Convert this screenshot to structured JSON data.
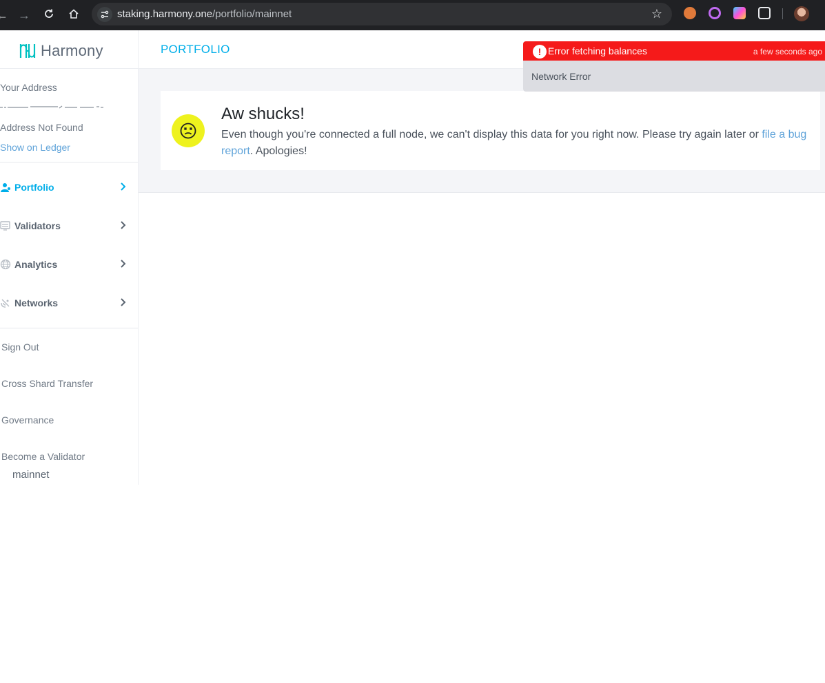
{
  "browser": {
    "url_host": "staking.harmony.one",
    "url_path": "/portfolio/mainnet"
  },
  "app": {
    "logo_text": "Harmony",
    "page_title": "PORTFOLIO"
  },
  "sidebar": {
    "address_label": "Your Address",
    "address_status": "Address Not Found",
    "show_ledger": "Show on Ledger",
    "menu": [
      {
        "label": "Portfolio",
        "icon": "user-icon",
        "active": true
      },
      {
        "label": "Validators",
        "icon": "validators-icon",
        "active": false
      },
      {
        "label": "Analytics",
        "icon": "globe-icon",
        "active": false
      },
      {
        "label": "Networks",
        "icon": "satellite-icon",
        "active": false
      }
    ],
    "links": [
      "Sign Out",
      "Cross Shard Transfer",
      "Governance",
      "Become a Validator"
    ],
    "network": "mainnet"
  },
  "card": {
    "title": "Aw shucks!",
    "body_before": "Even though you're connected a full node, we can't display this data for you right now. Please try again later or ",
    "link": "file a bug report",
    "body_after": ". Apologies!"
  },
  "toast": {
    "title": "Error fetching balances",
    "time": "a few seconds ago",
    "message": "Network Error"
  },
  "colors": {
    "accent": "#00aee9",
    "link": "#5fa3d9",
    "error": "#f51a1a",
    "sad_face": "#eef21e"
  }
}
